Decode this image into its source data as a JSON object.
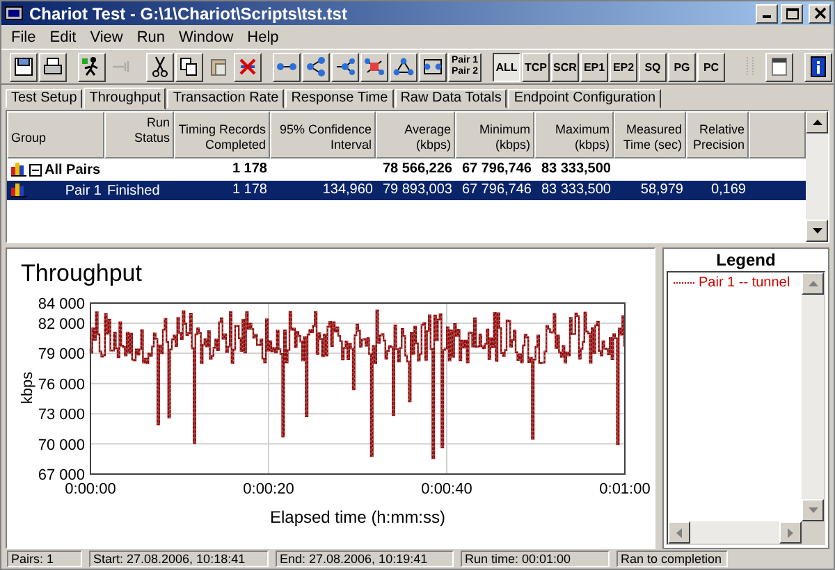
{
  "window": {
    "title": "Chariot Test - G:\\1\\Chariot\\Scripts\\tst.tst"
  },
  "menu": [
    "File",
    "Edit",
    "View",
    "Run",
    "Window",
    "Help"
  ],
  "toolbar": [
    {
      "kind": "icon",
      "disabled": false
    },
    {
      "kind": "icon",
      "disabled": false
    },
    {
      "kind": "icon",
      "disabled": false
    },
    {
      "kind": "icon",
      "disabled": true
    },
    {
      "kind": "icon",
      "disabled": false
    },
    {
      "kind": "icon",
      "disabled": false
    },
    {
      "kind": "icon",
      "disabled": true
    },
    {
      "kind": "icon",
      "disabled": false
    },
    {
      "kind": "icon",
      "disabled": false
    },
    {
      "kind": "icon",
      "disabled": false
    },
    {
      "kind": "icon",
      "disabled": false
    },
    {
      "kind": "icon",
      "disabled": false
    },
    {
      "kind": "icon",
      "disabled": false
    },
    {
      "kind": "icon",
      "disabled": false
    },
    {
      "kind": "text",
      "label": "Pair 1\nPair 2",
      "selected": false
    },
    {
      "kind": "text",
      "label": "ALL",
      "selected": true
    },
    {
      "kind": "text",
      "label": "TCP",
      "selected": false
    },
    {
      "kind": "text",
      "label": "SCR",
      "selected": false
    },
    {
      "kind": "text",
      "label": "EP1",
      "selected": false
    },
    {
      "kind": "text",
      "label": "EP2",
      "selected": false
    },
    {
      "kind": "text",
      "label": "SQ",
      "selected": false
    },
    {
      "kind": "text",
      "label": "PG",
      "selected": false
    },
    {
      "kind": "text",
      "label": "PC",
      "selected": false
    },
    {
      "kind": "icon",
      "disabled": true
    },
    {
      "kind": "icon",
      "disabled": false
    },
    {
      "kind": "icon",
      "disabled": false
    }
  ],
  "tabs": [
    {
      "label": "Test Setup",
      "selected": false
    },
    {
      "label": "Throughput",
      "selected": true
    },
    {
      "label": "Transaction Rate",
      "selected": false
    },
    {
      "label": "Response Time",
      "selected": false
    },
    {
      "label": "Raw Data Totals",
      "selected": false
    },
    {
      "label": "Endpoint Configuration",
      "selected": false
    }
  ],
  "table": {
    "columns": [
      "Group",
      "Run Status",
      "Timing Records Completed",
      "95% Confidence Interval",
      "Average (kbps)",
      "Minimum (kbps)",
      "Maximum (kbps)",
      "Measured Time (sec)",
      "Relative Precision"
    ],
    "rows": [
      {
        "kind": "group",
        "expanded": true,
        "selected": false,
        "cells": [
          "All Pairs",
          "",
          "1 178",
          "",
          "78 566,226",
          "67 796,746",
          "83 333,500",
          "",
          ""
        ]
      },
      {
        "kind": "pair",
        "selected": true,
        "cells": [
          "Pair 1",
          "Finished",
          "1 178",
          "134,960",
          "79 893,003",
          "67 796,746",
          "83 333,500",
          "58,979",
          "0,169"
        ]
      }
    ]
  },
  "chart": {
    "title": "Throughput",
    "ylabel": "kbps",
    "xlabel": "Elapsed time (h:mm:ss)",
    "yticks": [
      "84 000",
      "82 000",
      "79 000",
      "76 000",
      "73 000",
      "70 000",
      "67 000"
    ],
    "xticks": [
      "0:00:00",
      "0:00:20",
      "0:00:40",
      "0:01:00"
    ]
  },
  "legend": {
    "title": "Legend",
    "items": [
      {
        "label": "Pair 1 -- tunnel",
        "color": "#cc0000"
      }
    ]
  },
  "status_bar": [
    "Pairs: 1",
    "Start: 27.08.2006, 10:18:41",
    "End: 27.08.2006, 10:19:41",
    "Run time: 00:01:00",
    "Ran to completion"
  ]
}
